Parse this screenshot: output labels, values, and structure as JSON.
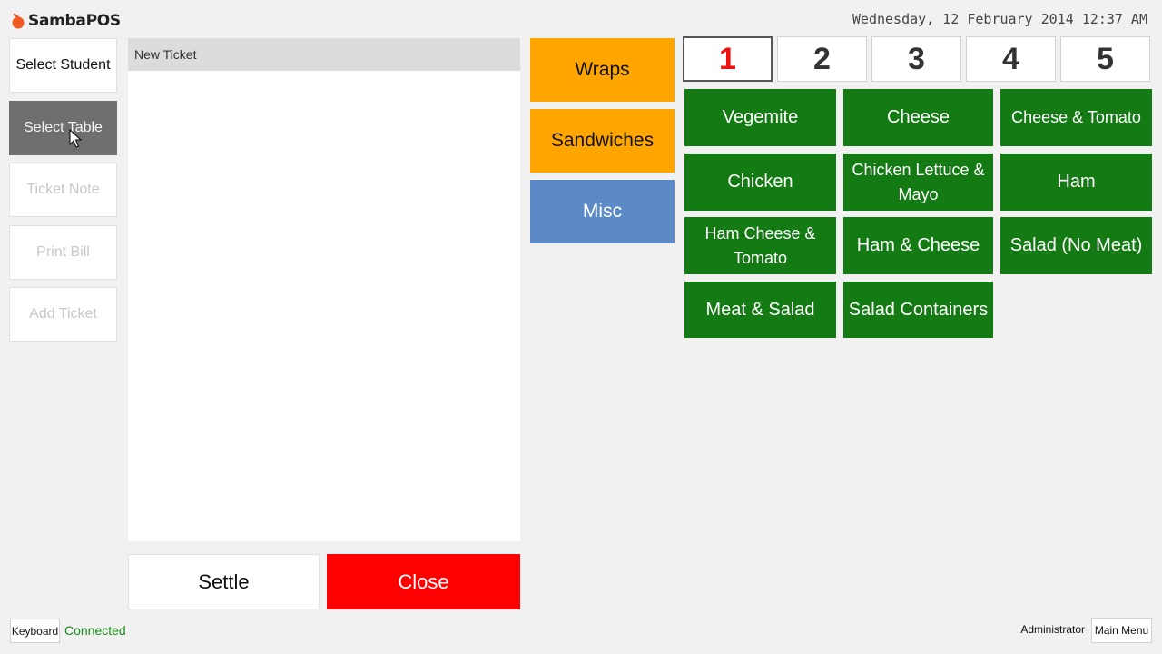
{
  "app": {
    "logo_text": "SambaPOS",
    "datetime": "Wednesday, 12 February 2014 12:37 AM"
  },
  "left_buttons": {
    "select_student": "Select Student",
    "select_table": "Select Table",
    "ticket_note": "Ticket Note",
    "print_bill": "Print Bill",
    "add_ticket": "Add Ticket"
  },
  "ticket": {
    "header": "New Ticket"
  },
  "actions": {
    "settle": "Settle",
    "close": "Close"
  },
  "categories": [
    "Wraps",
    "Sandwiches",
    "Misc"
  ],
  "pages": [
    "1",
    "2",
    "3",
    "4",
    "5"
  ],
  "menu_items": [
    "Vegemite",
    "Cheese",
    "Cheese & Tomato",
    "Chicken",
    "Chicken Lettuce & Mayo",
    "Ham",
    "Ham Cheese & Tomato",
    "Ham & Cheese",
    "Salad (No Meat)",
    "Meat & Salad",
    "Salad Containers"
  ],
  "footer": {
    "keyboard": "Keyboard",
    "status": "Connected",
    "user": "Administrator",
    "main_menu": "Main Menu"
  },
  "colors": {
    "category_orange": "#ffa500",
    "category_blue": "#5b8ac6",
    "menu_green": "#147a14",
    "close_red": "#ff0000",
    "selected_page_red": "#ee1111",
    "connected_green": "#1a8a1a"
  }
}
